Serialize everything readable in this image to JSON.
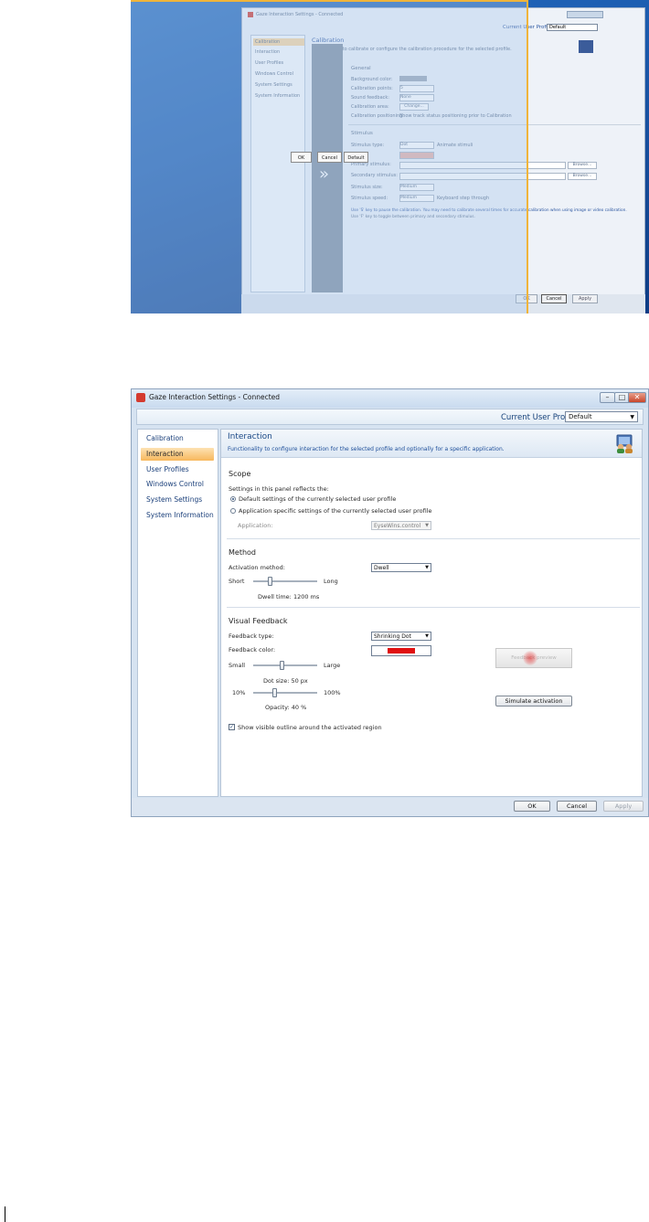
{
  "top_screenshot": {
    "window_title": "Gaze Interaction Settings - Connected",
    "profile_label": "Current User Profile",
    "profile_value": "Default",
    "nav_items": [
      "Calibration",
      "Interaction",
      "User Profiles",
      "Windows Control",
      "System Settings",
      "System Information"
    ],
    "page_title": "Calibration",
    "page_desc": "Functionality to calibrate or configure the calibration procedure for the selected profile.",
    "general_heading": "General",
    "general_labels": [
      "Background color:",
      "Calibration points:",
      "Sound feedback:",
      "Calibration area:",
      "Calibration positioning:"
    ],
    "general_values": [
      "",
      "5",
      "None",
      "Change...",
      "Show track status positioning prior to Calibration"
    ],
    "stimulus_heading": "Stimulus",
    "stimulus_type_label": "Stimulus type:",
    "stimulus_type_value": "Dot",
    "animate_label": "Animate stimuli",
    "primary_label": "Primary stimulus:",
    "secondary_label": "Secondary stimulus:",
    "browse1": "Browse...",
    "browse2": "Browse...",
    "stim_size_label": "Stimulus size:",
    "stim_size_value": "Medium",
    "stim_speed_label": "Stimulus speed:",
    "stim_speed_value": "Medium",
    "keyboard_label": "Keyboard step through",
    "hint_line1": "Use 'S' key to pause the calibration. You may need to calibrate several times for accurate calibration when using image or video calibration.",
    "hint_line2": "Use 'F' key to toggle between primary and secondary stimulus.",
    "chevron": "»",
    "overlay_buttons": [
      "OK",
      "Cancel",
      "Default"
    ],
    "dialog_buttons": [
      "OK",
      "Cancel",
      "Apply"
    ]
  },
  "bottom_screenshot": {
    "window_title": "Gaze Interaction Settings - Connected",
    "profile_label": "Current User Profile",
    "profile_value": "Default",
    "nav_items": [
      {
        "label": "Calibration",
        "selected": false
      },
      {
        "label": "Interaction",
        "selected": true
      },
      {
        "label": "User Profiles",
        "selected": false
      },
      {
        "label": "Windows Control",
        "selected": false
      },
      {
        "label": "System Settings",
        "selected": false
      },
      {
        "label": "System Information",
        "selected": false
      }
    ],
    "header": {
      "title": "Interaction",
      "description": "Functionality to configure interaction for the selected profile and optionally for a specific application."
    },
    "scope": {
      "heading": "Scope",
      "intro": "Settings in this panel reflects the:",
      "option_default": "Default settings of the currently selected user profile",
      "option_app": "Application specific settings of the currently selected user profile",
      "application_label": "Application:",
      "application_value": "EyseWins.control"
    },
    "method": {
      "heading": "Method",
      "activation_label": "Activation method:",
      "activation_value": "Dwell",
      "short_label": "Short",
      "long_label": "Long",
      "dwell_time": "Dwell time: 1200 ms",
      "dwell_level": 0.25
    },
    "visual_feedback": {
      "heading": "Visual Feedback",
      "type_label": "Feedback type:",
      "type_value": "Shrinking Dot",
      "color_label": "Feedback color:",
      "color_value": "#e01010",
      "small_label": "Small",
      "large_label": "Large",
      "dot_size": "Dot size: 50 px",
      "dot_level": 0.45,
      "min_opacity": "10%",
      "max_opacity": "100%",
      "opacity": "Opacity: 40 %",
      "opacity_level": 0.33,
      "outline_label": "Show visible outline around the activated region",
      "outline_checked": true,
      "preview_text": "Feedback preview",
      "simulate_label": "Simulate activation"
    },
    "buttons": {
      "ok": "OK",
      "cancel": "Cancel",
      "apply": "Apply"
    },
    "accent": "#f7b75c"
  }
}
